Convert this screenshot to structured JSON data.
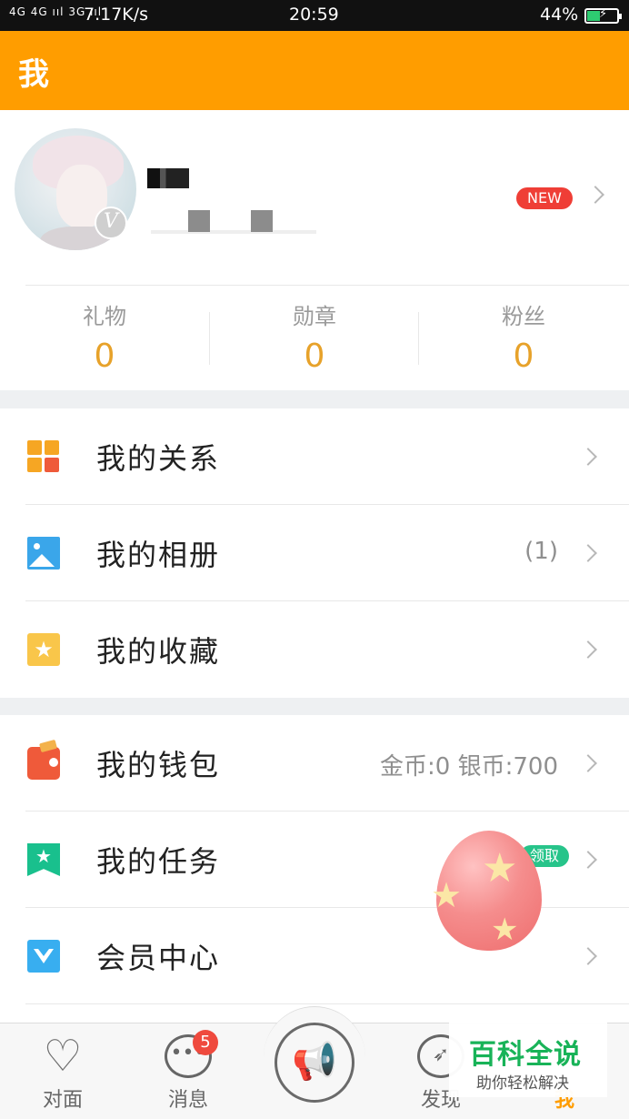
{
  "status_bar": {
    "signal": "4G 4G ııl 3G ııl",
    "speed": "7.17K/s",
    "time": "20:59",
    "battery": "44%"
  },
  "header": {
    "title": "我"
  },
  "profile": {
    "verified_badge": "V",
    "new_badge": "NEW"
  },
  "stats": [
    {
      "label": "礼物",
      "value": "0"
    },
    {
      "label": "勋章",
      "value": "0"
    },
    {
      "label": "粉丝",
      "value": "0"
    }
  ],
  "menu_group_1": [
    {
      "label": "我的关系",
      "icon": "grid-icon",
      "extra": ""
    },
    {
      "label": "我的相册",
      "icon": "photo-icon",
      "extra": "(1)"
    },
    {
      "label": "我的收藏",
      "icon": "star-icon",
      "extra": ""
    }
  ],
  "menu_group_2": [
    {
      "label": "我的钱包",
      "icon": "wallet-icon",
      "extra": "金币:0 银币:700"
    },
    {
      "label": "我的任务",
      "icon": "task-icon",
      "extra": "",
      "badge": "领取"
    },
    {
      "label": "会员中心",
      "icon": "vip-icon",
      "extra": ""
    }
  ],
  "tab_bar": {
    "tabs": [
      {
        "label": "对面",
        "icon": "heart-icon"
      },
      {
        "label": "消息",
        "icon": "chat-icon",
        "badge": "5"
      },
      {
        "label": "",
        "icon": "megaphone-icon"
      },
      {
        "label": "发现",
        "icon": "compass-icon"
      },
      {
        "label": "我",
        "icon": "me-icon"
      }
    ]
  },
  "watermark": {
    "title": "百科全说",
    "subtitle": "助你轻松解决"
  },
  "colors": {
    "accent": "#ff9d00",
    "stat_value": "#e7a22a",
    "badge_red": "#ef3e36",
    "claim_green": "#27c48a"
  }
}
